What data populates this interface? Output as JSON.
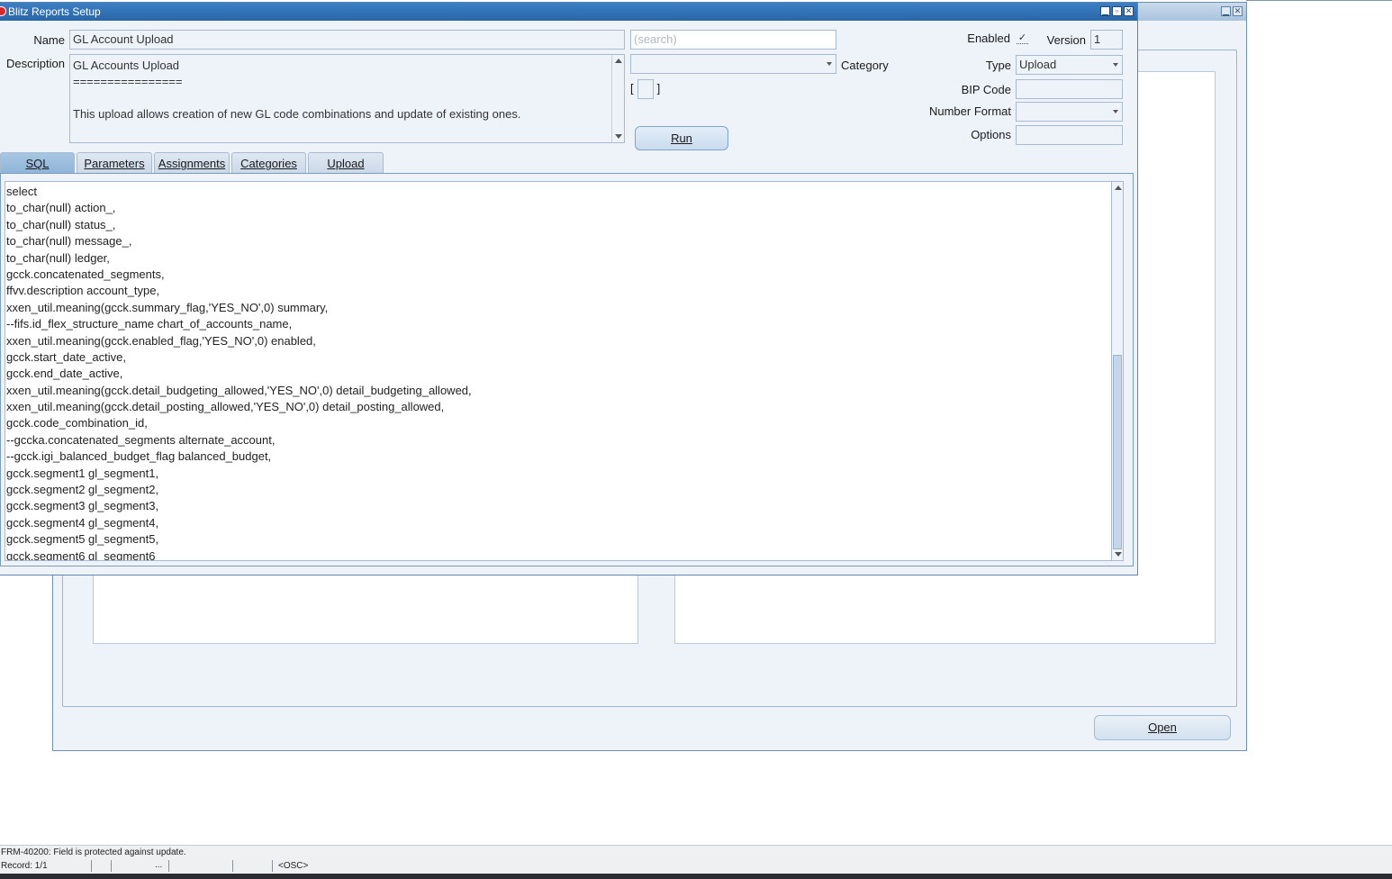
{
  "window": {
    "title": "Blitz Reports Setup",
    "controls": [
      "▁",
      "▫",
      "✕"
    ]
  },
  "form": {
    "name_label": "Name",
    "name_value": "GL Account Upload",
    "search_placeholder": "(search)",
    "description_label": "Description",
    "description_lines": [
      "GL Accounts Upload",
      "================",
      "",
      "This upload allows creation of new GL code combinations and update of existing ones."
    ],
    "category_label": "Category",
    "category_value": "",
    "bracket_open": "[",
    "bracket_close": "]",
    "run_label": "Run",
    "enabled_label": "Enabled",
    "enabled_mark": "✓",
    "version_label": "Version",
    "version_value": "1",
    "type_label": "Type",
    "type_value": "Upload",
    "bip_label": "BIP Code",
    "bip_value": "",
    "number_format_label": "Number Format",
    "number_format_value": "",
    "options_label": "Options",
    "options_value": ""
  },
  "tabs": [
    {
      "label": "SQL",
      "active": true
    },
    {
      "label": "Parameters",
      "active": false
    },
    {
      "label": "Assignments",
      "active": false
    },
    {
      "label": "Categories",
      "active": false
    },
    {
      "label": "Upload",
      "active": false
    }
  ],
  "sql_lines": [
    "select",
    "to_char(null) action_,",
    "to_char(null) status_,",
    "to_char(null) message_,",
    "to_char(null) ledger,",
    "gcck.concatenated_segments,",
    "ffvv.description account_type,",
    "xxen_util.meaning(gcck.summary_flag,'YES_NO',0) summary,",
    "--fifs.id_flex_structure_name chart_of_accounts_name,",
    "xxen_util.meaning(gcck.enabled_flag,'YES_NO',0) enabled,",
    "gcck.start_date_active,",
    "gcck.end_date_active,",
    "xxen_util.meaning(gcck.detail_budgeting_allowed,'YES_NO',0) detail_budgeting_allowed,",
    "xxen_util.meaning(gcck.detail_posting_allowed,'YES_NO',0) detail_posting_allowed,",
    "gcck.code_combination_id,",
    "--gccka.concatenated_segments alternate_account,",
    "--gcck.igi_balanced_budget_flag balanced_budget,",
    "gcck.segment1 gl_segment1,",
    "gcck.segment2 gl_segment2,",
    "gcck.segment3 gl_segment3,",
    "gcck.segment4 gl_segment4,",
    "gcck.segment5 gl_segment5,",
    "gcck.segment6 gl_segment6"
  ],
  "background": {
    "open_label": "Open",
    "controls": [
      "▁",
      "✕"
    ]
  },
  "status": {
    "message": "FRM-40200: Field is protected against update.",
    "record": "Record: 1/1",
    "dots": "...",
    "osc": "<OSC>"
  },
  "colors": {
    "titlebar": "#2a66a8",
    "panel": "#eef3f9",
    "active_tab": "#8fb4d8"
  }
}
